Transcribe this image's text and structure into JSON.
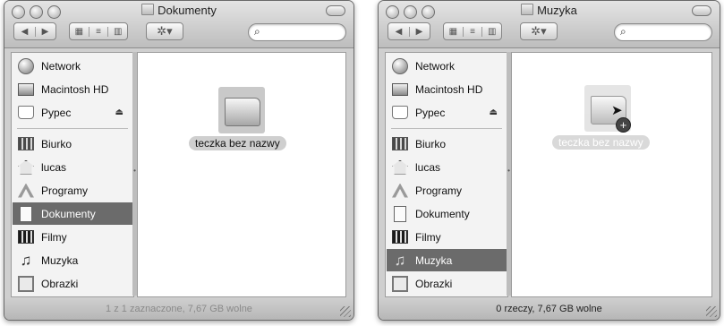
{
  "left_window": {
    "title": "Dokumenty",
    "sidebar": [
      {
        "label": "Network",
        "icon": "network-icon"
      },
      {
        "label": "Macintosh HD",
        "icon": "hard-disk-icon"
      },
      {
        "label": "Pypec",
        "icon": "disk-icon",
        "eject": "⏏"
      },
      {
        "label": "Biurko",
        "icon": "desktop-icon"
      },
      {
        "label": "lucas",
        "icon": "home-icon"
      },
      {
        "label": "Programy",
        "icon": "applications-icon"
      },
      {
        "label": "Dokumenty",
        "icon": "documents-icon",
        "selected": true
      },
      {
        "label": "Filmy",
        "icon": "movies-icon"
      },
      {
        "label": "Muzyka",
        "icon": "music-icon"
      },
      {
        "label": "Obrazki",
        "icon": "pictures-icon"
      }
    ],
    "folder_label": "teczka bez nazwy",
    "status": "1 z 1 zaznaczone, 7,67 GB wolne"
  },
  "right_window": {
    "title": "Muzyka",
    "sidebar": [
      {
        "label": "Network",
        "icon": "network-icon"
      },
      {
        "label": "Macintosh HD",
        "icon": "hard-disk-icon"
      },
      {
        "label": "Pypec",
        "icon": "disk-icon",
        "eject": "⏏"
      },
      {
        "label": "Biurko",
        "icon": "desktop-icon"
      },
      {
        "label": "lucas",
        "icon": "home-icon"
      },
      {
        "label": "Programy",
        "icon": "applications-icon"
      },
      {
        "label": "Dokumenty",
        "icon": "documents-icon"
      },
      {
        "label": "Filmy",
        "icon": "movies-icon"
      },
      {
        "label": "Muzyka",
        "icon": "music-icon",
        "selected": true
      },
      {
        "label": "Obrazki",
        "icon": "pictures-icon"
      }
    ],
    "folder_label": "teczka bez nazwy",
    "copy_badge": "+",
    "status": "0 rzeczy, 7,67 GB wolne"
  },
  "toolbar": {
    "back": "◀",
    "forward": "▶",
    "view_icon": "▦",
    "view_list": "≡",
    "view_column": "▥",
    "action": "✲▾",
    "search_icon": "⌕"
  },
  "divider_glyph": "•"
}
